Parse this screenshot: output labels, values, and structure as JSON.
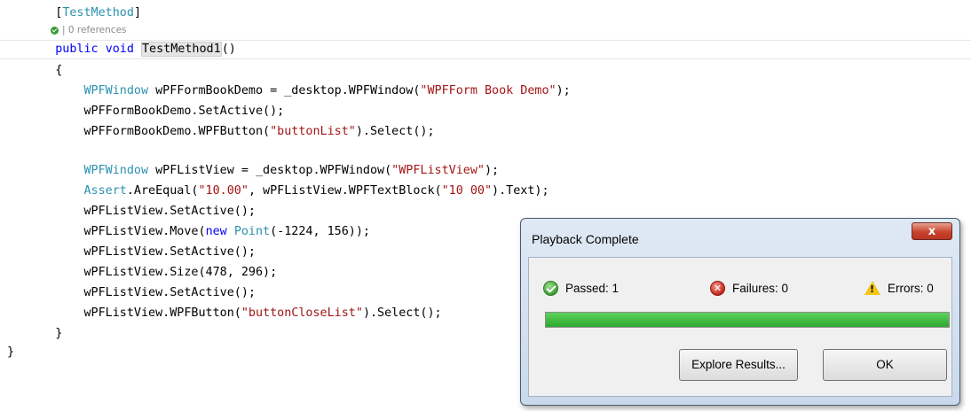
{
  "editor": {
    "lines": [
      {
        "indent": "    ",
        "parts": [
          {
            "t": "[",
            "c": ""
          },
          {
            "t": "TestMethod",
            "c": "attr"
          },
          {
            "t": "]",
            "c": ""
          }
        ]
      },
      {
        "indent": "    ",
        "parts": [
          {
            "t": "public",
            "c": "kw"
          },
          {
            "t": " ",
            "c": ""
          },
          {
            "t": "void",
            "c": "kw"
          },
          {
            "t": " ",
            "c": ""
          },
          {
            "t": "TestMethod1",
            "c": "highlight"
          },
          {
            "t": "()",
            "c": ""
          }
        ]
      },
      {
        "indent": "    ",
        "parts": [
          {
            "t": "{",
            "c": ""
          }
        ]
      },
      {
        "indent": "        ",
        "parts": [
          {
            "t": "WPFWindow",
            "c": "ty"
          },
          {
            "t": " wPFFormBookDemo = _desktop.WPFWindow(",
            "c": ""
          },
          {
            "t": "\"WPFForm Book Demo\"",
            "c": "st"
          },
          {
            "t": ");",
            "c": ""
          }
        ]
      },
      {
        "indent": "        ",
        "parts": [
          {
            "t": "wPFFormBookDemo.SetActive();",
            "c": ""
          }
        ]
      },
      {
        "indent": "        ",
        "parts": [
          {
            "t": "wPFFormBookDemo.WPFButton(",
            "c": ""
          },
          {
            "t": "\"buttonList\"",
            "c": "st"
          },
          {
            "t": ").Select();",
            "c": ""
          }
        ]
      },
      {
        "indent": "",
        "parts": []
      },
      {
        "indent": "        ",
        "parts": [
          {
            "t": "WPFWindow",
            "c": "ty"
          },
          {
            "t": " wPFListView = _desktop.WPFWindow(",
            "c": ""
          },
          {
            "t": "\"WPFListView\"",
            "c": "st"
          },
          {
            "t": ");",
            "c": ""
          }
        ]
      },
      {
        "indent": "        ",
        "parts": [
          {
            "t": "Assert",
            "c": "ty"
          },
          {
            "t": ".AreEqual(",
            "c": ""
          },
          {
            "t": "\"10.00\"",
            "c": "st"
          },
          {
            "t": ", wPFListView.WPFTextBlock(",
            "c": ""
          },
          {
            "t": "\"10 00\"",
            "c": "st"
          },
          {
            "t": ").Text);",
            "c": ""
          }
        ]
      },
      {
        "indent": "        ",
        "parts": [
          {
            "t": "wPFListView.SetActive();",
            "c": ""
          }
        ]
      },
      {
        "indent": "        ",
        "parts": [
          {
            "t": "wPFListView.Move(",
            "c": ""
          },
          {
            "t": "new",
            "c": "kw"
          },
          {
            "t": " ",
            "c": ""
          },
          {
            "t": "Point",
            "c": "ty"
          },
          {
            "t": "(-1224, 156));",
            "c": ""
          }
        ]
      },
      {
        "indent": "        ",
        "parts": [
          {
            "t": "wPFListView.SetActive();",
            "c": ""
          }
        ]
      },
      {
        "indent": "        ",
        "parts": [
          {
            "t": "wPFListView.Size(478, 296);",
            "c": ""
          }
        ]
      },
      {
        "indent": "        ",
        "parts": [
          {
            "t": "wPFListView.SetActive();",
            "c": ""
          }
        ]
      },
      {
        "indent": "        ",
        "parts": [
          {
            "t": "wPFListView.WPFButton(",
            "c": ""
          },
          {
            "t": "\"buttonCloseList\"",
            "c": "st"
          },
          {
            "t": ").Select();",
            "c": ""
          }
        ]
      },
      {
        "indent": "    ",
        "parts": [
          {
            "t": "}",
            "c": ""
          }
        ]
      },
      {
        "indent": "",
        "parts": [
          {
            "t": "}",
            "c": ""
          }
        ]
      }
    ],
    "codelens": {
      "text": "| 0 references",
      "icon": "check-circle-icon"
    }
  },
  "dialog": {
    "title": "Playback Complete",
    "close_label": "x",
    "passed_label": "Passed: 1",
    "failures_label": "Failures: 0",
    "errors_label": "Errors: 0",
    "progress_fraction": 1.0,
    "explore_button_label": "Explore Results...",
    "ok_button_label": "OK",
    "colors": {
      "pass": "#3f9d36",
      "fail": "#c4271a",
      "warn": "#f3c318",
      "progress": "#2fa82f"
    }
  }
}
